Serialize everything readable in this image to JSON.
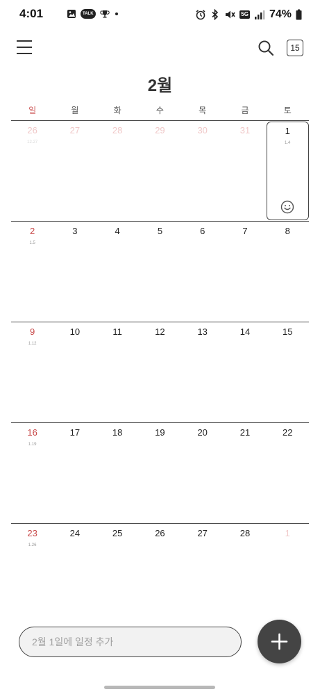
{
  "status_bar": {
    "time": "4:01",
    "talk_badge": "TALK",
    "network": "5G",
    "battery": "74%"
  },
  "header": {
    "today_day": "15",
    "month_title": "2월"
  },
  "weekdays": [
    "일",
    "월",
    "화",
    "수",
    "목",
    "금",
    "토"
  ],
  "weeks": [
    [
      {
        "num": "26",
        "lunar": "12.27",
        "type": "other"
      },
      {
        "num": "27",
        "lunar": "",
        "type": "other"
      },
      {
        "num": "28",
        "lunar": "",
        "type": "other"
      },
      {
        "num": "29",
        "lunar": "",
        "type": "other"
      },
      {
        "num": "30",
        "lunar": "",
        "type": "other"
      },
      {
        "num": "31",
        "lunar": "",
        "type": "other"
      },
      {
        "num": "1",
        "lunar": "1.4",
        "type": "normal",
        "selected": true
      }
    ],
    [
      {
        "num": "2",
        "lunar": "1.5",
        "type": "sun"
      },
      {
        "num": "3",
        "lunar": "",
        "type": "normal"
      },
      {
        "num": "4",
        "lunar": "",
        "type": "normal"
      },
      {
        "num": "5",
        "lunar": "",
        "type": "normal"
      },
      {
        "num": "6",
        "lunar": "",
        "type": "normal"
      },
      {
        "num": "7",
        "lunar": "",
        "type": "normal"
      },
      {
        "num": "8",
        "lunar": "",
        "type": "normal"
      }
    ],
    [
      {
        "num": "9",
        "lunar": "1.12",
        "type": "sun"
      },
      {
        "num": "10",
        "lunar": "",
        "type": "normal"
      },
      {
        "num": "11",
        "lunar": "",
        "type": "normal"
      },
      {
        "num": "12",
        "lunar": "",
        "type": "normal"
      },
      {
        "num": "13",
        "lunar": "",
        "type": "normal"
      },
      {
        "num": "14",
        "lunar": "",
        "type": "normal"
      },
      {
        "num": "15",
        "lunar": "",
        "type": "normal"
      }
    ],
    [
      {
        "num": "16",
        "lunar": "1.19",
        "type": "sun"
      },
      {
        "num": "17",
        "lunar": "",
        "type": "normal"
      },
      {
        "num": "18",
        "lunar": "",
        "type": "normal"
      },
      {
        "num": "19",
        "lunar": "",
        "type": "normal"
      },
      {
        "num": "20",
        "lunar": "",
        "type": "normal"
      },
      {
        "num": "21",
        "lunar": "",
        "type": "normal"
      },
      {
        "num": "22",
        "lunar": "",
        "type": "normal"
      }
    ],
    [
      {
        "num": "23",
        "lunar": "1.26",
        "type": "sun"
      },
      {
        "num": "24",
        "lunar": "",
        "type": "normal"
      },
      {
        "num": "25",
        "lunar": "",
        "type": "normal"
      },
      {
        "num": "26",
        "lunar": "",
        "type": "normal"
      },
      {
        "num": "27",
        "lunar": "",
        "type": "normal"
      },
      {
        "num": "28",
        "lunar": "",
        "type": "normal"
      },
      {
        "num": "1",
        "lunar": "",
        "type": "other"
      }
    ]
  ],
  "add_event": {
    "placeholder": "2월 1일에 일정 추가"
  },
  "icons": {
    "menu": "hamburger-icon",
    "search": "search-icon",
    "fab": "plus-icon",
    "selected_day": "smiley-icon"
  },
  "colors": {
    "sunday": "#c84848",
    "other_month": "#f0c8c8",
    "fab": "#444444"
  }
}
